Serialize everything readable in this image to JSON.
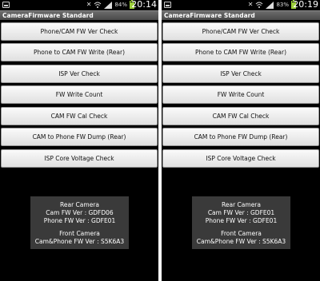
{
  "screens": [
    {
      "status": {
        "battery_percent": "84%",
        "time": "20:14",
        "battery_level": 0.84
      },
      "app_title": "CameraFirmware Standard",
      "buttons": [
        "Phone/CAM FW Ver Check",
        "Phone to CAM FW Write (Rear)",
        "ISP Ver Check",
        "FW Write Count",
        "CAM FW Cal Check",
        "CAM to Phone FW Dump (Rear)",
        "ISP Core Voltage Check"
      ],
      "info": {
        "rear_heading": "Rear Camera",
        "cam_fw_ver": "Cam FW Ver : GDFD06",
        "phone_fw_ver": "Phone FW Ver : GDFE01",
        "front_heading": "Front Camera",
        "cam_phone_fw_ver": "Cam&Phone FW Ver : S5K6A3"
      }
    },
    {
      "status": {
        "battery_percent": "83%",
        "time": "20:19",
        "battery_level": 0.83
      },
      "app_title": "CameraFirmware Standard",
      "buttons": [
        "Phone/CAM FW Ver Check",
        "Phone to CAM FW Write (Rear)",
        "ISP Ver Check",
        "FW Write Count",
        "CAM FW Cal Check",
        "CAM to Phone FW Dump (Rear)",
        "ISP Core Voltage Check"
      ],
      "info": {
        "rear_heading": "Rear Camera",
        "cam_fw_ver": "Cam FW Ver : GDFE01",
        "phone_fw_ver": "Phone FW Ver : GDFE01",
        "front_heading": "Front Camera",
        "cam_phone_fw_ver": "Cam&Phone FW Ver : S5K6A3"
      }
    }
  ],
  "icons": {
    "notification": "notification-icon",
    "mute": "mute-icon",
    "wifi": "wifi-icon",
    "signal": "signal-icon",
    "battery": "battery-icon"
  },
  "colors": {
    "screen_background": "#000000",
    "title_bar": "#5a5a5a",
    "button_face": "#efefef",
    "info_box": "#3a3a3a",
    "battery": "#9ccf3a"
  }
}
